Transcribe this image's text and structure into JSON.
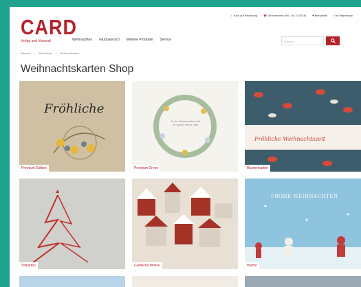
{
  "logo": {
    "main": "CARD",
    "sub": "Verlag und Versand"
  },
  "topbar": [
    "✓ Kauf auf Rechnung",
    "Sie erreichen 089 - 84 74 83 35",
    "Merkzettel",
    "Ihr Warenkorb"
  ],
  "nav": [
    "Weihnachten",
    "Glückwunsch",
    "Weitere Produkte",
    "Service"
  ],
  "search": {
    "placeholder": "Suchen..."
  },
  "breadcrumb": [
    "Startseite",
    "Weihnachten",
    "Weihnachtskarten"
  ],
  "page_title": "Weihnachtskarten Shop",
  "cards": [
    {
      "caption": "Premium Edition",
      "art_text": "Fröhliche"
    },
    {
      "caption": "Premium Green",
      "art_text": "Frohe Weihnachten und ein gutes neues Jahr"
    },
    {
      "caption": "Blumenkarten",
      "art_text": "Fröhliche Weihnachtszeit"
    },
    {
      "caption": "Stilkarten"
    },
    {
      "caption": "Grafische Motive"
    },
    {
      "caption": "Humor",
      "art_text": "FROHE WEIHNACHTEN"
    }
  ],
  "colors": {
    "brand": "#b4232d",
    "frame": "#1fa38e"
  }
}
